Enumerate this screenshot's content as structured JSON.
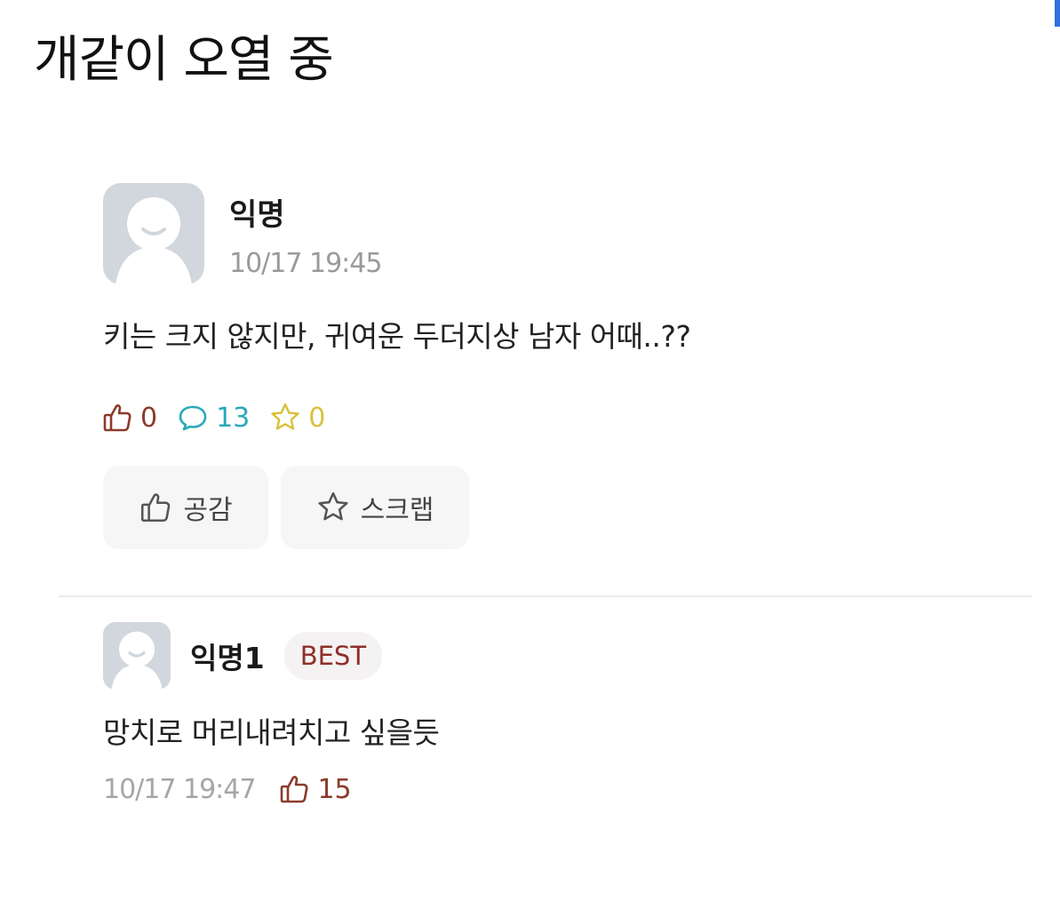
{
  "caption": "개같이 오열 중",
  "post": {
    "author": "익명",
    "date": "10/17 19:45",
    "body": "키는 크지 않지만, 귀여운 두더지상 남자 어때..??",
    "likes": "0",
    "comments": "13",
    "scraps": "0",
    "empathy_button": "공감",
    "scrap_button": "스크랩"
  },
  "comment": {
    "author": "익명1",
    "badge": "BEST",
    "body": "망치로 머리내려치고 싶을듯",
    "date": "10/17 19:47",
    "likes": "15"
  },
  "colors": {
    "like": "#8b3b2b",
    "comment": "#2aa9b8",
    "scrap": "#d9c13a",
    "badge_text": "#8f2f2a",
    "avatar_bg": "#d2d7dd"
  },
  "icons": [
    "thumbs-up-icon",
    "speech-bubble-icon",
    "star-icon",
    "default-avatar-icon"
  ]
}
